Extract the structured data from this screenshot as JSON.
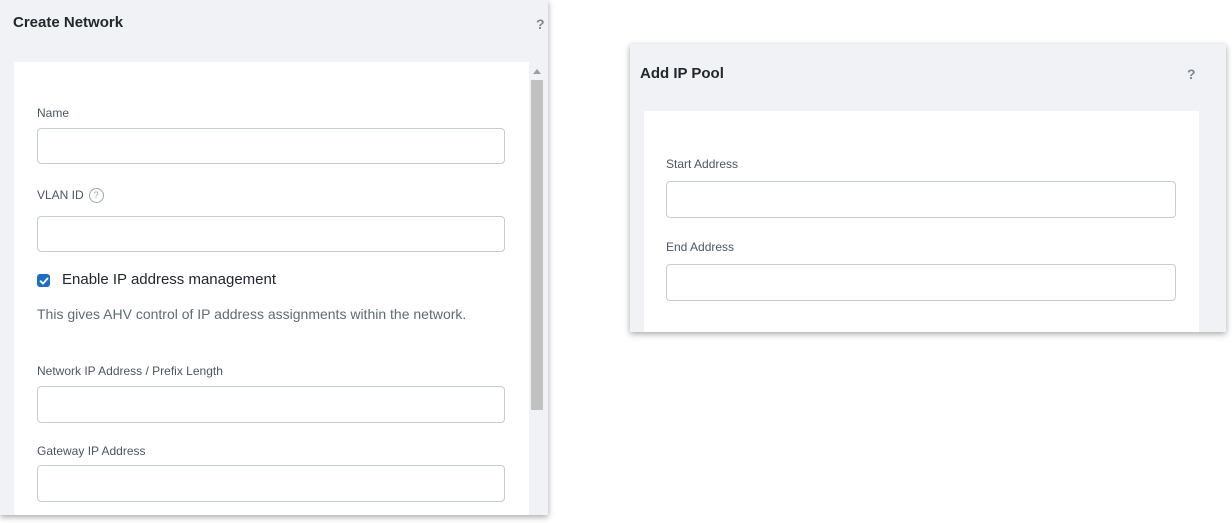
{
  "create_network": {
    "title": "Create Network",
    "help": "?",
    "name_label": "Name",
    "name_value": "",
    "vlan_label": "VLAN ID",
    "vlan_info": "?",
    "vlan_value": "",
    "enable_ipam": {
      "checked": true,
      "label": "Enable IP address management"
    },
    "ipam_description": "This gives AHV control of IP address assignments within the network.",
    "network_ip_label": "Network IP Address / Prefix Length",
    "network_ip_value": "",
    "gateway_label": "Gateway IP Address",
    "gateway_value": ""
  },
  "add_ip_pool": {
    "title": "Add IP Pool",
    "help": "?",
    "start_label": "Start Address",
    "start_value": "",
    "end_label": "End Address",
    "end_value": ""
  },
  "colors": {
    "accent": "#1b6ec2",
    "panel_bg": "#f0f2f5",
    "border": "#c6ccd3"
  }
}
